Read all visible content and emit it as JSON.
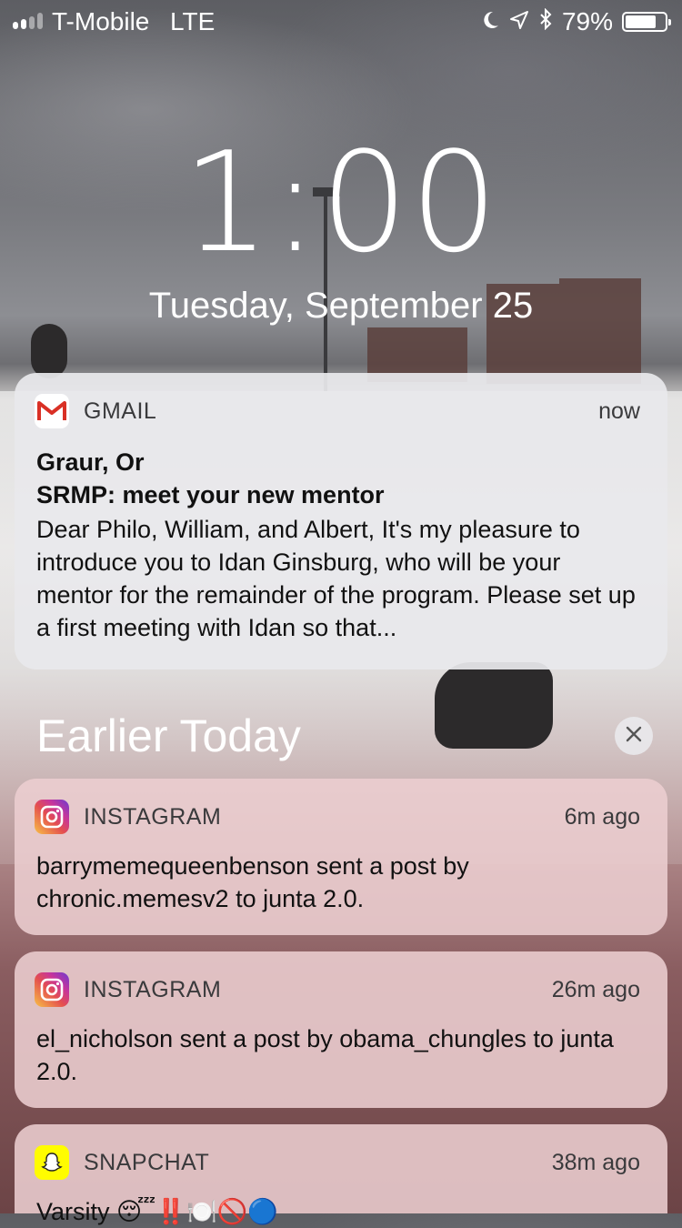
{
  "status_bar": {
    "carrier": "T-Mobile",
    "network": "LTE",
    "battery_percent": "79%",
    "battery_level": 0.79,
    "icons": [
      "moon-icon",
      "location-arrow-icon",
      "bluetooth-icon",
      "battery-icon"
    ]
  },
  "lock_screen": {
    "time": "1:00",
    "date": "Tuesday, September 25"
  },
  "notifications": [
    {
      "app": "GMAIL",
      "icon": "gmail-icon",
      "time": "now",
      "sender": "Graur, Or",
      "subject": "SRMP: meet your new mentor",
      "message": "Dear Philo, William, and Albert, It's my pleasure to introduce you to Idan Ginsburg, who will be your mentor for the remainder of the program. Please set up a first meeting with Idan so that..."
    }
  ],
  "earlier": {
    "title": "Earlier Today",
    "items": [
      {
        "app": "INSTAGRAM",
        "icon": "instagram-icon",
        "time": "6m ago",
        "message": "barrymemequeenbenson sent a post by chronic.memesv2 to junta 2.0."
      },
      {
        "app": "INSTAGRAM",
        "icon": "instagram-icon",
        "time": "26m ago",
        "message": "el_nicholson sent a post by obama_chungles to junta 2.0."
      },
      {
        "app": "SNAPCHAT",
        "icon": "snapchat-icon",
        "time": "38m ago",
        "message": "Varsity 😴‼️🍽️🚫🔵"
      }
    ]
  },
  "colors": {
    "card_light": "#e8e8ec",
    "card_pink": "#ecced0",
    "gmail_red": "#d93025",
    "snapchat_yellow": "#fffc00"
  }
}
